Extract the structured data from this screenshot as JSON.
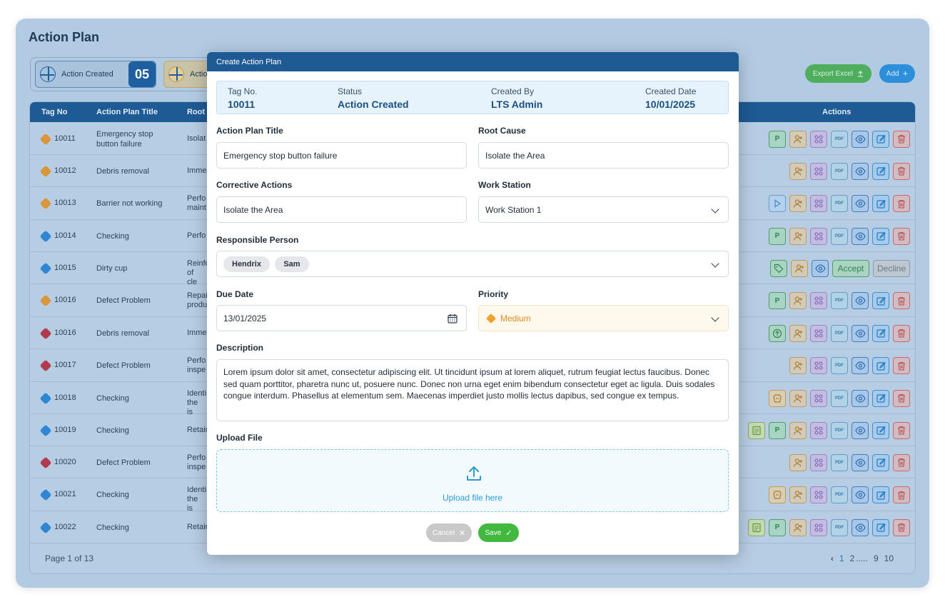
{
  "page": {
    "title": "Action Plan"
  },
  "summary": {
    "card1_label": "Action Created",
    "card1_count": "05",
    "card2_label": "Action"
  },
  "toolbar": {
    "export_label": "Export Excel",
    "add_label": "Add"
  },
  "table": {
    "headers": {
      "tag_no": "Tag No",
      "title": "Action Plan Title",
      "root": "Root",
      "actions": "Actions"
    },
    "rows": [
      {
        "tag": "10011",
        "title": "Emergency stop button failure",
        "root": "Isolat"
      },
      {
        "tag": "10012",
        "title": "Debris removal",
        "root": "Imme"
      },
      {
        "tag": "10013",
        "title": "Barrier not working",
        "root": "Perfo maint"
      },
      {
        "tag": "10014",
        "title": "Checking",
        "root": "Perfo"
      },
      {
        "tag": "10015",
        "title": "Dirty cup",
        "root": "Reinfo of cle"
      },
      {
        "tag": "10016",
        "title": "Defect Problem",
        "root": "Repai produ"
      },
      {
        "tag": "10016",
        "title": "Debris removal",
        "root": "Imme"
      },
      {
        "tag": "10017",
        "title": "Defect Problem",
        "root": "Perfo inspe"
      },
      {
        "tag": "10018",
        "title": "Checking",
        "root": "Identi the is"
      },
      {
        "tag": "10019",
        "title": "Checking",
        "root": "Retair"
      },
      {
        "tag": "10020",
        "title": "Defect Problem",
        "root": "Perfo inspe"
      },
      {
        "tag": "10021",
        "title": "Checking",
        "root": "Identi the is"
      },
      {
        "tag": "10022",
        "title": "Checking",
        "root": "Retair"
      }
    ],
    "accept_label": "Accept",
    "decline_label": "Decline",
    "p_label": "P",
    "pdf_label": "PDF"
  },
  "pagination": {
    "info": "Page 1 of 13",
    "prev": "‹",
    "p1": "1",
    "p2": "2",
    "ellipsis": ".....",
    "p9": "9",
    "p10": "10"
  },
  "modal": {
    "title": "Create Action Plan",
    "info": {
      "tag_label": "Tag No.",
      "tag_value": "10011",
      "status_label": "Status",
      "status_value": "Action Created",
      "created_by_label": "Created By",
      "created_by_value": "LTS Admin",
      "created_date_label": "Created Date",
      "created_date_value": "10/01/2025"
    },
    "fields": {
      "action_plan_title_label": "Action Plan Title",
      "action_plan_title_value": "Emergency stop button failure",
      "root_cause_label": "Root Cause",
      "root_cause_value": "Isolate the Area",
      "corrective_actions_label": "Corrective Actions",
      "corrective_actions_value": "Isolate the Area",
      "work_station_label": "Work Station",
      "work_station_value": "Work Station 1",
      "responsible_person_label": "Responsible Person",
      "responsible_persons": [
        "Hendrix",
        "Sam"
      ],
      "due_date_label": "Due Date",
      "due_date_value": "13/01/2025",
      "priority_label": "Priority",
      "priority_value": "Medium",
      "description_label": "Description",
      "description_value": "Lorem ipsum dolor sit amet, consectetur adipiscing elit. Ut tincidunt ipsum at lorem aliquet, rutrum feugiat lectus faucibus. Donec sed quam porttitor, pharetra nunc ut, posuere nunc. Donec non urna eget enim bibendum consectetur eget ac ligula. Duis sodales congue interdum. Phasellus at elementum sem. Maecenas imperdiet justo mollis lectus dapibus, sed congue ex tempus.",
      "upload_label": "Upload File",
      "upload_text": "Upload file here"
    },
    "cancel_label": "Cancel",
    "save_label": "Save"
  },
  "colors": {
    "primary": "#1e5a93",
    "accent": "#2d8fd9",
    "success": "#43b83f",
    "warning": "#e08a1e"
  }
}
